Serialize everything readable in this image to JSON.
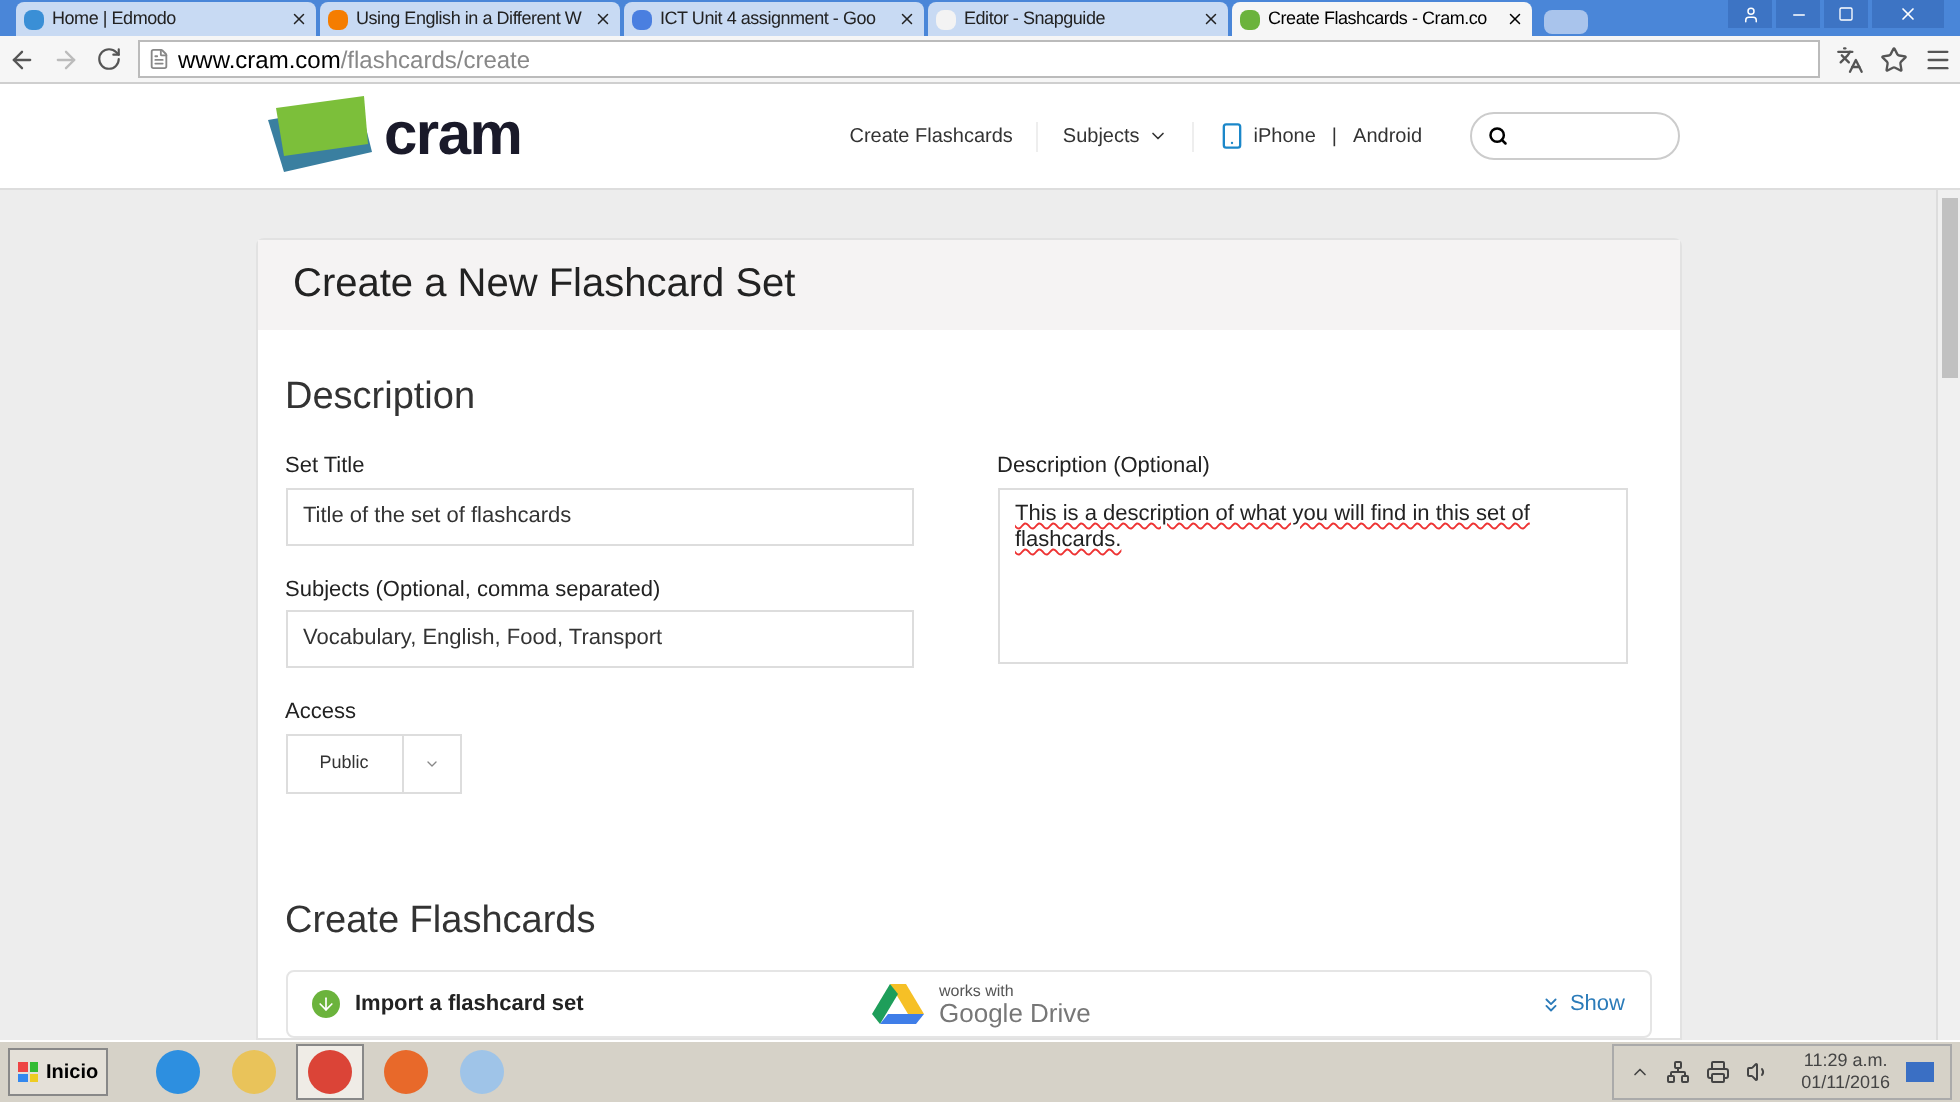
{
  "browser": {
    "tabs": [
      {
        "title": "Home | Edmodo",
        "kind": "edmodo",
        "selected": false
      },
      {
        "title": "Using English in a Different W",
        "kind": "blogger",
        "selected": false
      },
      {
        "title": "ICT Unit 4 assignment - Goo",
        "kind": "docs",
        "selected": false
      },
      {
        "title": "Editor - Snapguide",
        "kind": "snapguide",
        "selected": false
      },
      {
        "title": "Create Flashcards - Cram.co",
        "kind": "cram",
        "selected": true
      }
    ],
    "url_host": "www.cram.com",
    "url_path": "/flashcards/create"
  },
  "site_header": {
    "logo": "cram",
    "nav": [
      "Create Flashcards",
      "Subjects"
    ],
    "apps": [
      "iPhone",
      "|",
      "Android"
    ]
  },
  "form": {
    "title": "Create a New Flashcard Set",
    "section": "Description",
    "set_title": {
      "label": "Set Title",
      "value": "Title of the set of flashcards"
    },
    "subjects": {
      "label": "Subjects (Optional, comma separated)",
      "value": "Vocabulary, English, Food, Transport"
    },
    "access": {
      "label": "Access",
      "value": "Public"
    },
    "description": {
      "label": "Description (Optional)",
      "value": "This is a description of what you will find in this set of flashcards."
    },
    "create_heading": "Create Flashcards",
    "import": {
      "label": "Import a flashcard set",
      "works_with": "works with",
      "service": "Google Drive",
      "toggle": "Show"
    }
  },
  "taskbar": {
    "start": "Inicio",
    "apps": [
      {
        "kind": "ie",
        "selected": false
      },
      {
        "kind": "folder",
        "selected": false
      },
      {
        "kind": "chrome",
        "selected": true
      },
      {
        "kind": "firefox",
        "selected": false
      },
      {
        "kind": "paint",
        "selected": false
      }
    ],
    "time": "11:29 a.m.",
    "date": "01/11/2016"
  }
}
